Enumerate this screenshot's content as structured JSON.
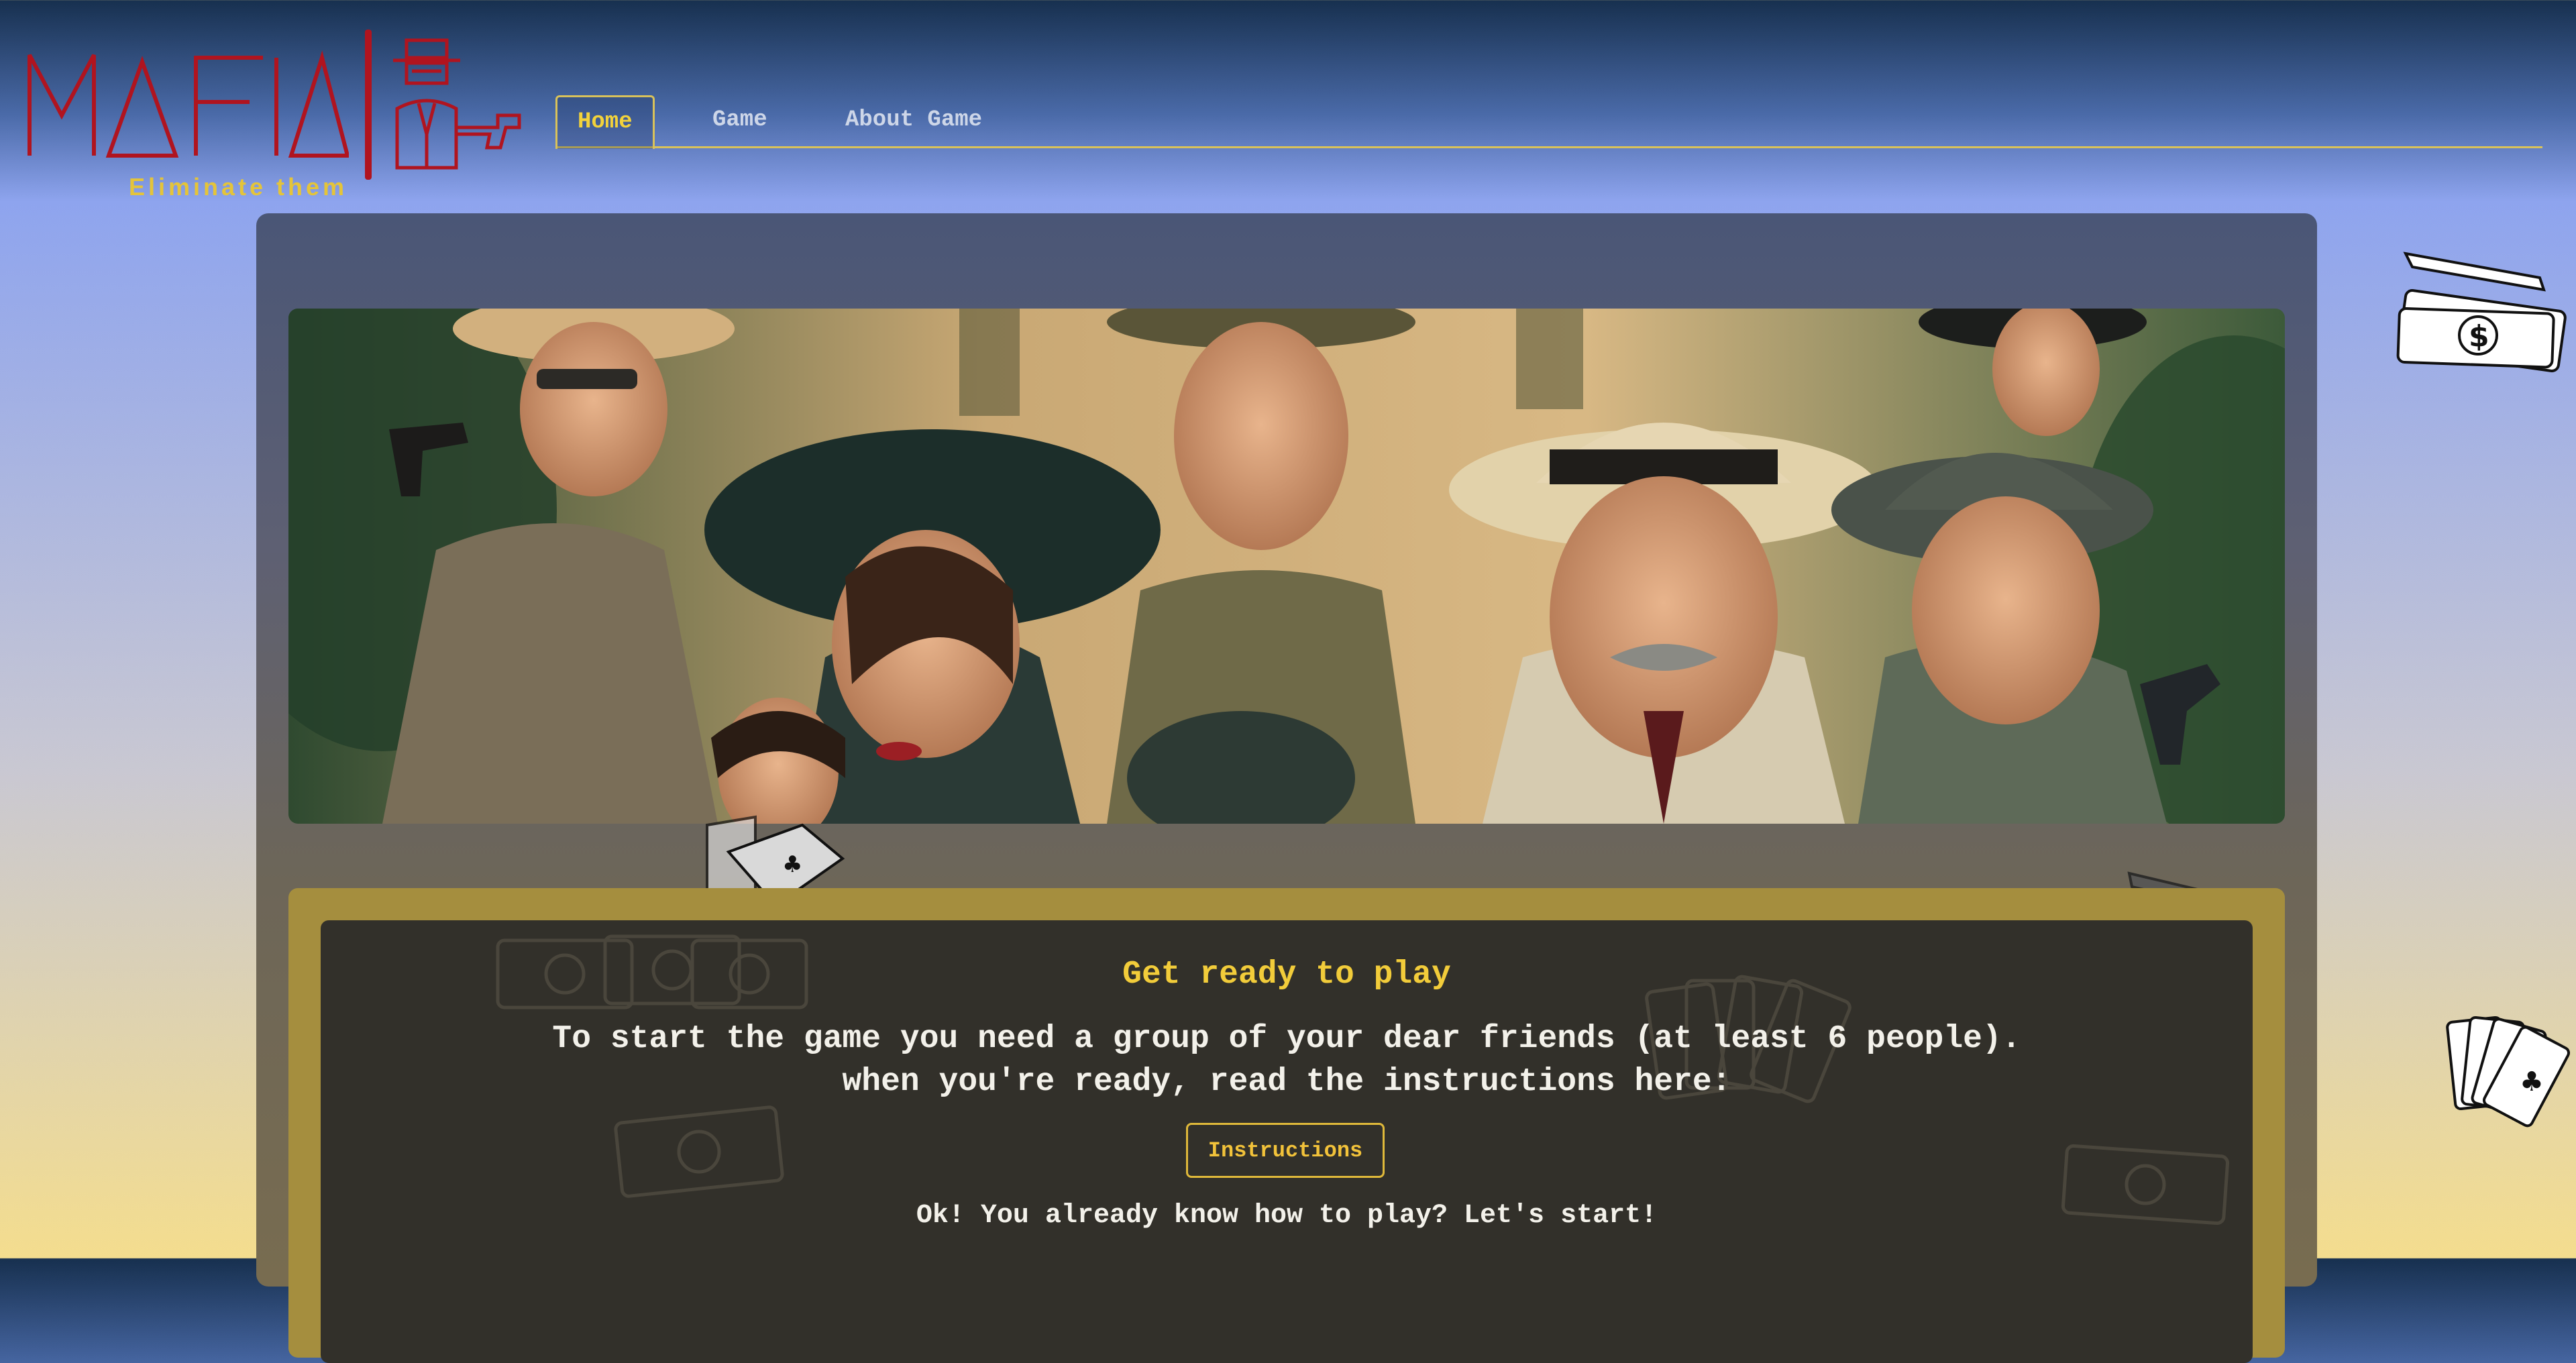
{
  "logo": {
    "wordmark": "MAFIA",
    "tagline": "Eliminate them"
  },
  "nav": {
    "tabs": [
      {
        "label": "Home",
        "active": true
      },
      {
        "label": "Game",
        "active": false
      },
      {
        "label": "About Game",
        "active": false
      }
    ]
  },
  "hero": {
    "image": "mafia-characters-illustration"
  },
  "intro": {
    "title": "Get ready to play",
    "line1": "To start the game you need a group of your dear friends (at least 6 people).",
    "line2": "when you're ready, read the instructions here:",
    "instructions_button": "Instructions",
    "start_text": "Ok! You already know how to play? Let's start!"
  },
  "colors": {
    "accent": "#f2cc3a",
    "logo_red": "#b0141f",
    "frame_gold": "#a58e3e",
    "content_bg": "#32302a"
  },
  "icons": [
    "money-gun-icon",
    "playing-cards-icon",
    "revolver-icon",
    "money-stack-icon",
    "card-fan-icon"
  ]
}
